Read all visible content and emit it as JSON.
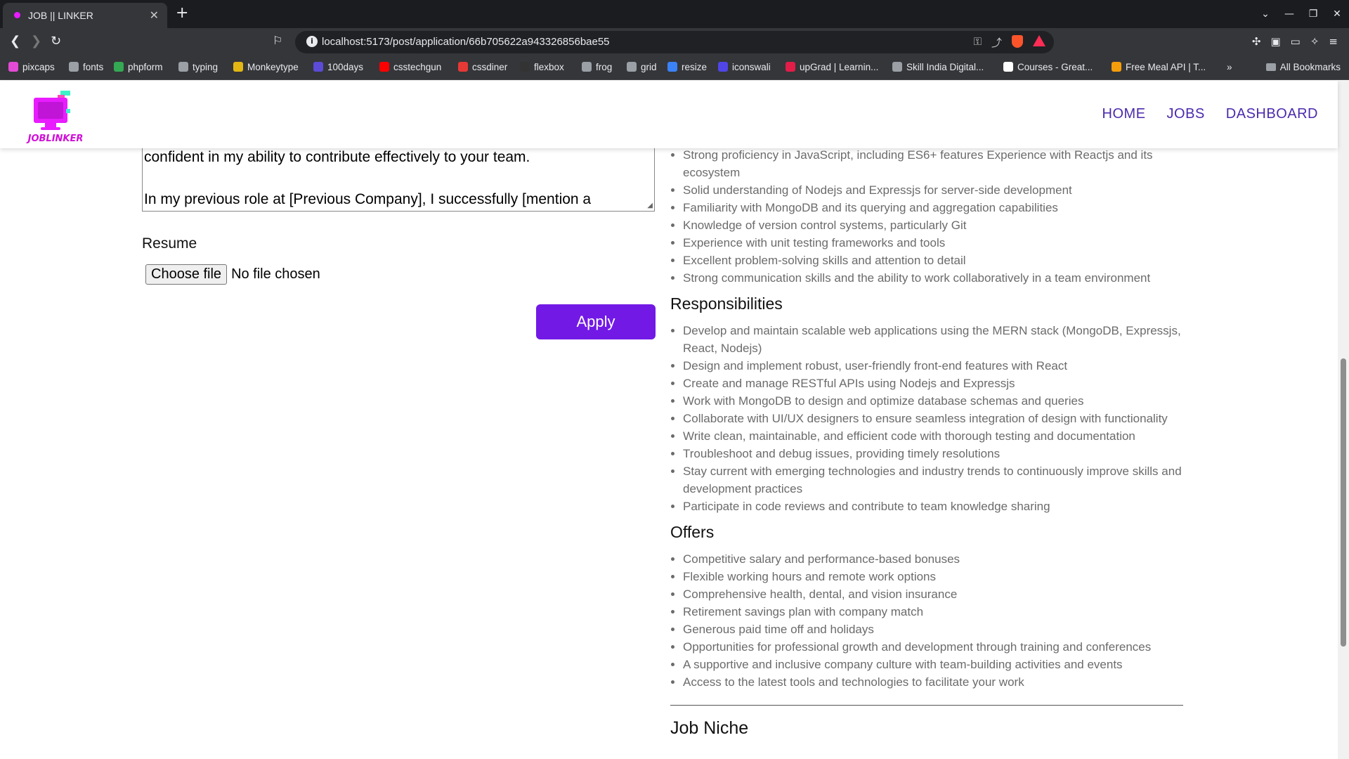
{
  "browser": {
    "tab_title": "JOB || LINKER",
    "url": "localhost:5173/post/application/66b705622a943326856bae55",
    "bookmarks": [
      {
        "label": "pixcaps",
        "color": "#e34bd6"
      },
      {
        "label": "fonts",
        "color": "#9aa0a6"
      },
      {
        "label": "phpform",
        "color": "#34a853"
      },
      {
        "label": "typing",
        "color": "#9aa0a6"
      },
      {
        "label": "Monkeytype",
        "color": "#e2b714"
      },
      {
        "label": "100days",
        "color": "#5b4bd6"
      },
      {
        "label": "csstechgun",
        "color": "#ff0000"
      },
      {
        "label": "cssdiner",
        "color": "#e53935"
      },
      {
        "label": "flexbox",
        "color": "#333333"
      },
      {
        "label": "frog",
        "color": "#9aa0a6"
      },
      {
        "label": "grid",
        "color": "#9aa0a6"
      },
      {
        "label": "resize",
        "color": "#3b82f6"
      },
      {
        "label": "iconswali",
        "color": "#4f46e5"
      },
      {
        "label": "upGrad | Learnin...",
        "color": "#e11d48"
      },
      {
        "label": "Skill India Digital...",
        "color": "#9aa0a6"
      },
      {
        "label": "Courses - Great...",
        "color": "#ffffff"
      },
      {
        "label": "Free Meal API | T...",
        "color": "#f59e0b"
      }
    ],
    "all_bookmarks": "All Bookmarks"
  },
  "header": {
    "logo_text": "JOBLINKER",
    "nav": [
      "HOME",
      "JOBS",
      "DASHBOARD"
    ]
  },
  "form": {
    "cover_letter": "with hands-on experience in [relevant skills or technologies], I am\nconfident in my ability to contribute effectively to your team.\n\nIn my previous role at [Previous Company], I successfully [mention a",
    "resume_label": "Resume",
    "file_button": "Choose file",
    "file_status": "No file chosen",
    "apply_label": "Apply"
  },
  "details": {
    "qualifications": [
      "Strong proficiency in JavaScript, including ES6+ features Experience with Reactjs and its ecosystem",
      "Solid understanding of Nodejs and Expressjs for server-side development",
      "Familiarity with MongoDB and its querying and aggregation capabilities",
      "Knowledge of version control systems, particularly Git",
      "Experience with unit testing frameworks and tools",
      "Excellent problem-solving skills and attention to detail",
      "Strong communication skills and the ability to work collaboratively in a team environment"
    ],
    "responsibilities_title": "Responsibilities",
    "responsibilities": [
      "Develop and maintain scalable web applications using the MERN stack (MongoDB, Expressjs, React, Nodejs)",
      "Design and implement robust, user-friendly front-end features with React",
      "Create and manage RESTful APIs using Nodejs and Expressjs",
      "Work with MongoDB to design and optimize database schemas and queries",
      "Collaborate with UI/UX designers to ensure seamless integration of design with functionality",
      "Write clean, maintainable, and efficient code with thorough testing and documentation",
      "Troubleshoot and debug issues, providing timely resolutions",
      "Stay current with emerging technologies and industry trends to continuously improve skills and development practices",
      "Participate in code reviews and contribute to team knowledge sharing"
    ],
    "offers_title": "Offers",
    "offers": [
      "Competitive salary and performance-based bonuses",
      "Flexible working hours and remote work options",
      "Comprehensive health, dental, and vision insurance",
      "Retirement savings plan with company match",
      "Generous paid time off and holidays",
      "Opportunities for professional growth and development through training and conferences",
      "A supportive and inclusive company culture with team-building activities and events",
      "Access to the latest tools and technologies to facilitate your work"
    ],
    "niche_title": "Job Niche"
  },
  "colors": {
    "accent": "#7219e6",
    "nav": "#4b2aad",
    "logo_magenta": "#e81cff"
  }
}
